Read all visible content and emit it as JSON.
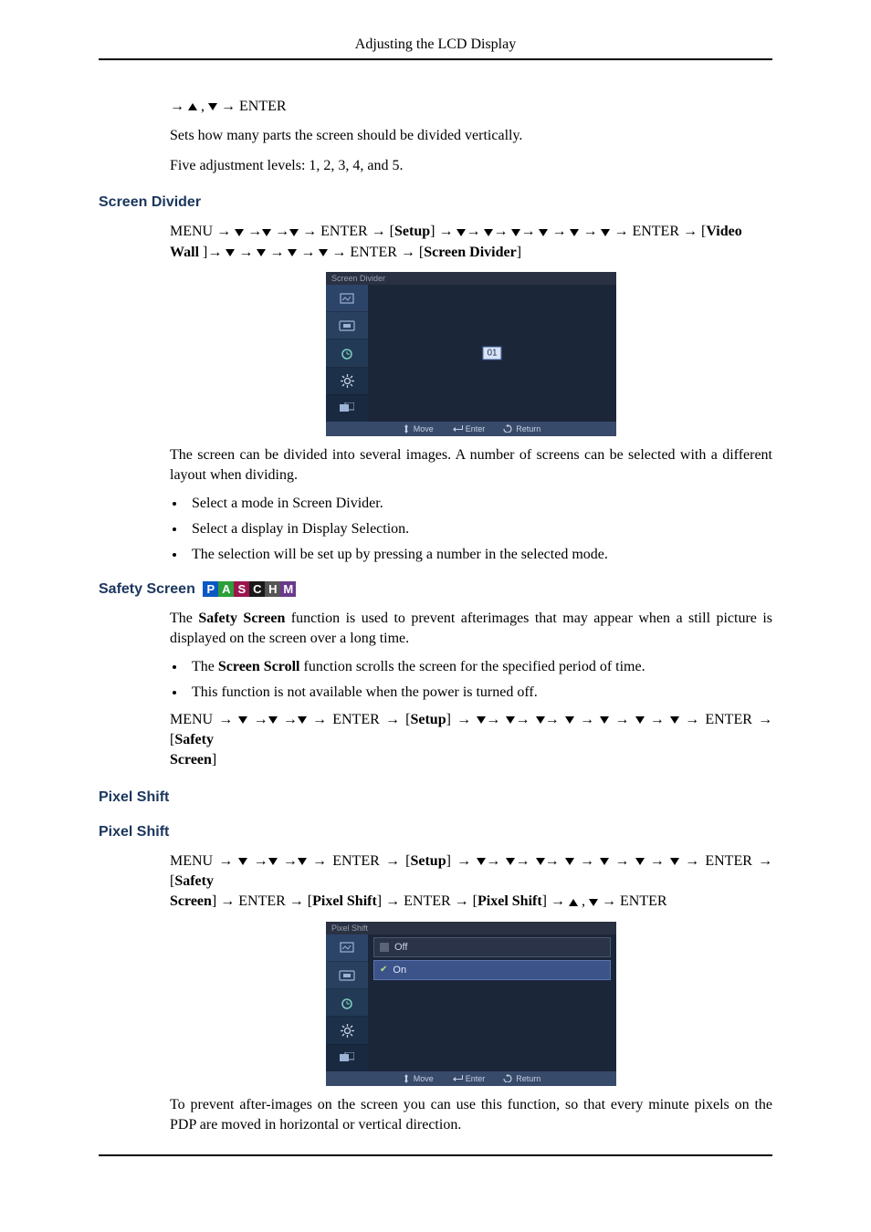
{
  "header": {
    "title": "Adjusting the LCD Display"
  },
  "intro": {
    "nav_tail": " → ENTER",
    "desc": "Sets how many parts the screen should be divided vertically.",
    "levels": "Five adjustment levels: 1, 2, 3, 4, and 5."
  },
  "screen_divider": {
    "heading": "Screen Divider",
    "nav_line1_a": "MENU → ",
    "nav_line1_b": " → ENTER → [",
    "nav_line1_setup": "Setup",
    "nav_line1_c": "] → ",
    "nav_line1_d": " → ENTER → [",
    "nav_line1_video": "Video",
    "nav_line2_wall": "Wall",
    "nav_line2_a": " ]→ ",
    "nav_line2_b": " → ENTER → [",
    "nav_line2_sd": "Screen Divider",
    "nav_line2_c": "]",
    "osd_title": "Screen Divider",
    "osd_value": "01",
    "osd_footer": {
      "move": "Move",
      "enter": "Enter",
      "return": "Return"
    },
    "para": "The screen can be divided into several images. A number of screens can be selected with a different layout when dividing.",
    "bul1": "Select a mode in Screen Divider.",
    "bul2": "Select a display in Display Selection.",
    "bul3": "The selection will be set up by pressing a number in the selected mode."
  },
  "safety_screen": {
    "heading": "Safety Screen",
    "badges": [
      "P",
      "A",
      "S",
      "C",
      "H",
      "M"
    ],
    "para_a": "The ",
    "para_bold": "Safety Screen",
    "para_b": " function is used to prevent afterimages that may appear when a still picture is displayed on the screen over a long time.",
    "bul1_a": "The ",
    "bul1_bold": "Screen Scroll",
    "bul1_b": " function scrolls the screen for the specified period of time.",
    "bul2": "This function is not available when the power is turned off.",
    "nav_a": "MENU → ",
    "nav_b": " → ENTER → [",
    "nav_setup": "Setup",
    "nav_c": "] → ",
    "nav_d": " → ENTER → [",
    "nav_safety": "Safety",
    "nav_screen": "Screen",
    "nav_e": "]"
  },
  "pixel_shift": {
    "heading1": "Pixel Shift",
    "heading2": "Pixel Shift",
    "nav1_a": "MENU → ",
    "nav1_b": " → ENTER → [",
    "nav1_setup": "Setup",
    "nav1_c": "] → ",
    "nav1_d": " → ENTER → [",
    "nav1_safety": "Safety",
    "nav2_screen": "Screen",
    "nav2_a": "] → ENTER → [",
    "nav2_ps1": "Pixel Shift",
    "nav2_b": "] → ENTER → [",
    "nav2_ps2": "Pixel Shift",
    "nav2_c": "] → ",
    "nav2_d": " → ENTER",
    "osd_title": "Pixel Shift",
    "opt_off": "Off",
    "opt_on": "On",
    "osd_footer": {
      "move": "Move",
      "enter": "Enter",
      "return": "Return"
    },
    "para": "To prevent after-images on the screen you can use this function, so that every minute pixels on the PDP are moved in horizontal or vertical direction."
  }
}
